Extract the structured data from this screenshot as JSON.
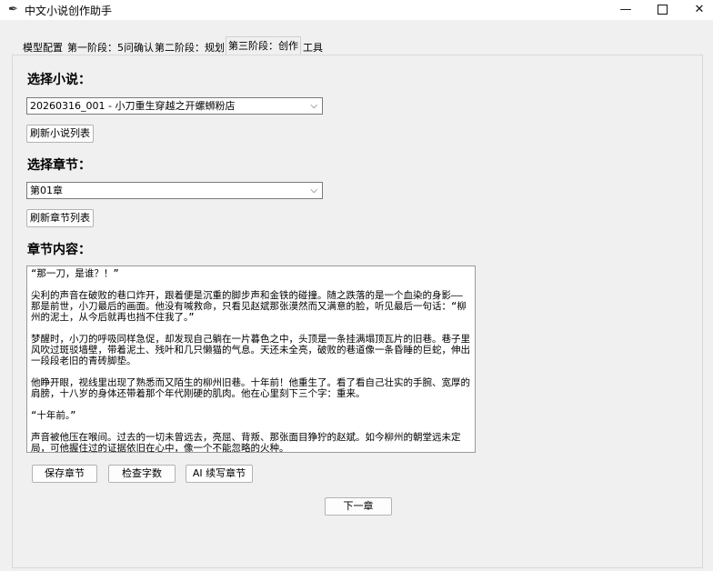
{
  "window": {
    "title": "中文小说创作助手",
    "minimize": "—",
    "close": "✕"
  },
  "tabs": [
    {
      "label": "模型配置",
      "active": false
    },
    {
      "label": "第一阶段：5问确认",
      "active": false
    },
    {
      "label": "第二阶段：规划",
      "active": false
    },
    {
      "label": "第三阶段：创作",
      "active": true
    },
    {
      "label": "工具",
      "active": false
    }
  ],
  "novel": {
    "label": "选择小说：",
    "selected": "20260316_001 - 小刀重生穿越之开螺蛳粉店",
    "refresh_button": "刷新小说列表"
  },
  "chapter": {
    "label": "选择章节：",
    "selected": "第01章",
    "refresh_button": "刷新章节列表"
  },
  "content": {
    "label": "章节内容：",
    "paragraphs": [
      "“那一刀，是谁？！”",
      "尖利的声音在破败的巷口炸开，跟着便是沉重的脚步声和金铁的碰撞。随之跌落的是一个血染的身影——那是前世，小刀最后的画面。他没有喊救命，只看见赵斌那张漠然而又满意的脸，听见最后一句话：“柳州的泥土，从今后就再也挡不住我了。”",
      "梦醒时，小刀的呼吸同样急促，却发现自己躺在一片暮色之中，头顶是一条挂满塌顶瓦片的旧巷。巷子里风吹过斑驳墙壁，带着泥土、残叶和几只懒猫的气息。天还未全亮，破败的巷道像一条昏睡的巨蛇，伸出一段段老旧的青砖脚垫。",
      "他睁开眼，视线里出现了熟悉而又陌生的柳州旧巷。十年前！他重生了。看了看自己壮实的手腕、宽厚的肩膀，十八岁的身体还带着那个年代刚硬的肌肉。他在心里刻下三个字：重来。",
      "“十年前。”",
      "声音被他压在喉间。过去的一切未曾远去，亮屈、背叛、那张面目狰狞的赵斌。如今柳州的朝堂远未定局，可他握住过的证据依旧在心中，像一个不能忽略的火种。"
    ]
  },
  "actions": {
    "save": "保存章节",
    "count": "检查字数",
    "ai_continue": "AI 续写章节",
    "next": "下一章"
  },
  "icons": {
    "app": "feather-icon",
    "dropdown": "chevron-down-icon"
  }
}
